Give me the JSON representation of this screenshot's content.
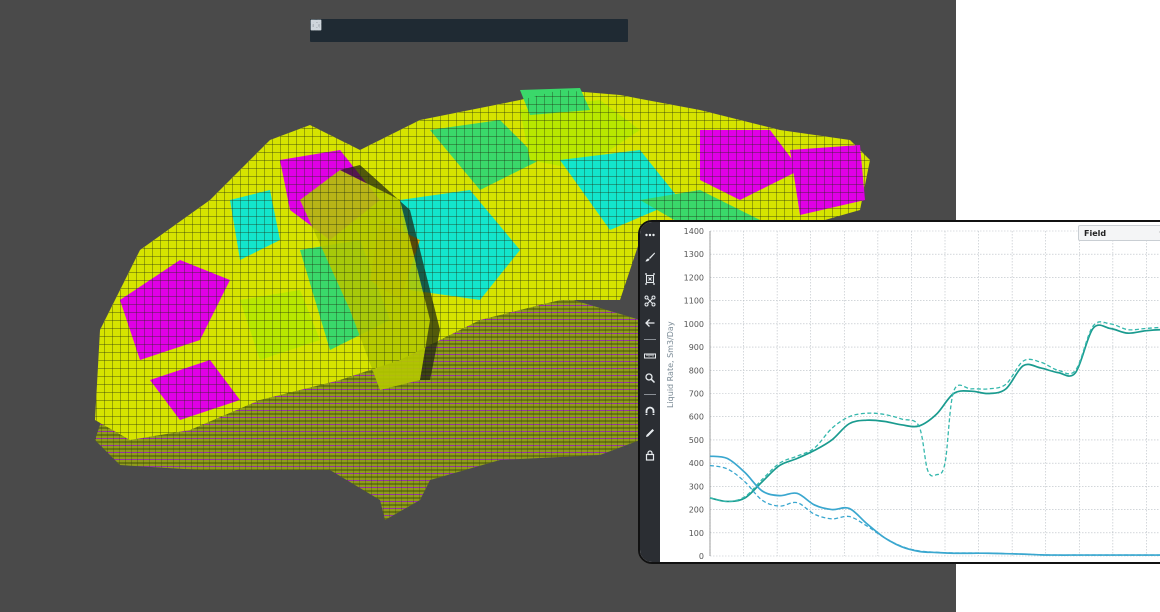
{
  "viewport": {
    "toolbar": {
      "tools": [
        {
          "icon": "path-icon"
        },
        {
          "icon": "box-icon"
        },
        {
          "icon": "lasso-icon"
        },
        {
          "icon": "cross-square-icon"
        },
        {
          "icon": "slash-square-icon"
        },
        {
          "icon": "frame-icon"
        },
        {
          "icon": "grid-icon"
        },
        {
          "icon": "pen-icon"
        },
        {
          "icon": "target-icon"
        },
        {
          "icon": "well-icon"
        },
        {
          "icon": "chart-icon"
        },
        {
          "icon": "focus-icon"
        }
      ]
    },
    "palette": {
      "yellow": "#e8f000",
      "lime": "#b8e800",
      "green": "#3ad86a",
      "cyan": "#13e6cc",
      "magenta": "#e000e6",
      "orange": "#e8a800",
      "background": "#4a4a4a"
    }
  },
  "chart_panel": {
    "sidebar_icons": [
      "menu-dots-icon",
      "brush-icon",
      "select-box-icon",
      "nodes-icon",
      "back-arrow-icon",
      "ruler-icon",
      "zoom-icon",
      "magnet-icon",
      "pencil-icon",
      "lock-icon"
    ],
    "dropdown": {
      "selected": "Field"
    },
    "chart_data": {
      "type": "line",
      "ylabel": "Liquid Rate, Sm3/Day",
      "ylim": [
        0,
        1400
      ],
      "yticks": [
        0,
        100,
        200,
        300,
        400,
        500,
        600,
        700,
        800,
        900,
        1000,
        1100,
        1200,
        1300,
        1400
      ],
      "xlim": [
        0,
        27
      ],
      "grid": true,
      "series": [
        {
          "color": "#1a9b8f",
          "dash": false,
          "x": [
            0,
            1,
            2,
            3,
            4,
            5,
            6,
            7,
            8,
            9,
            10,
            11,
            12,
            13,
            14,
            15,
            16,
            17,
            18,
            19,
            20,
            21,
            22,
            23,
            24,
            25,
            26,
            27
          ],
          "y": [
            250,
            235,
            250,
            320,
            390,
            420,
            455,
            500,
            570,
            585,
            580,
            565,
            560,
            610,
            700,
            710,
            700,
            720,
            820,
            810,
            790,
            790,
            980,
            980,
            960,
            970,
            975,
            975
          ]
        },
        {
          "color": "#35b8ad",
          "dash": true,
          "x": [
            0,
            1,
            2,
            3,
            4,
            5,
            6,
            7,
            8,
            9,
            10,
            11,
            12,
            12.5,
            13,
            13.5,
            14,
            15,
            16,
            17,
            18,
            19,
            20,
            21,
            22,
            23,
            24,
            25,
            26,
            27
          ],
          "y": [
            250,
            235,
            255,
            330,
            400,
            430,
            465,
            550,
            600,
            615,
            610,
            590,
            560,
            370,
            350,
            400,
            710,
            720,
            720,
            740,
            840,
            835,
            800,
            800,
            990,
            1000,
            975,
            980,
            985,
            985
          ]
        },
        {
          "color": "#3aa7cf",
          "dash": false,
          "x": [
            0,
            1,
            2,
            3,
            4,
            5,
            6,
            7,
            8,
            9,
            10,
            11,
            12,
            13,
            14,
            15,
            16,
            17,
            18,
            19,
            20,
            21,
            22,
            23,
            24,
            25,
            26,
            27
          ],
          "y": [
            430,
            420,
            360,
            280,
            260,
            270,
            220,
            200,
            205,
            140,
            80,
            40,
            20,
            15,
            12,
            12,
            12,
            10,
            8,
            5,
            4,
            4,
            4,
            4,
            4,
            4,
            4,
            4
          ]
        },
        {
          "color": "#3aa7cf",
          "dash": true,
          "x": [
            0,
            1,
            2,
            3,
            4,
            5,
            6,
            7,
            8,
            9,
            10,
            11,
            12,
            13,
            14,
            15,
            16,
            17,
            18,
            19,
            20,
            21,
            22,
            23,
            24,
            25,
            26,
            27
          ],
          "y": [
            390,
            375,
            320,
            240,
            215,
            230,
            180,
            160,
            170,
            130,
            80,
            42,
            22,
            16,
            13,
            13,
            12,
            10,
            8,
            5,
            4,
            4,
            4,
            4,
            4,
            4,
            4,
            4
          ]
        }
      ]
    }
  }
}
